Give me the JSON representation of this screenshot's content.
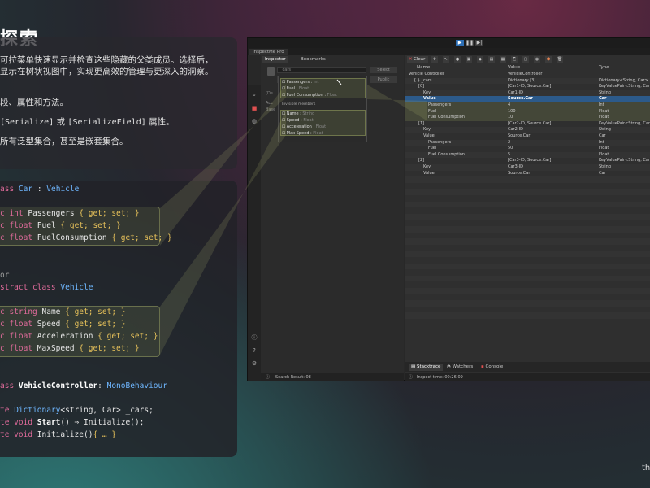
{
  "slide": {
    "title": "探索",
    "desc_lines": [
      "可拉菜单快速显示并检查这些隐藏的父类成员。选择后，",
      "显示在树状视图中，实现更高效的管理与更深入的洞察。",
      "段、属性和方法。",
      "或",
      "属性。",
      "所有泛型集合，甚至是嵌套集合。"
    ],
    "attr_serialize": "[Serialize]",
    "attr_serializefield": "[SerializeField]",
    "cut_text": "th"
  },
  "code": {
    "line1_kw": "ass",
    "line1_name": "Car",
    "line1_sep": ":",
    "line1_base": "Vehicle",
    "line2": "{",
    "p1_kw": "c int",
    "p1_name": "Passengers",
    "p2_kw": "c float",
    "p2_name": "Fuel",
    "p3_kw": "c float",
    "p3_name": "FuelConsumption",
    "accessors": "{ get; set; }",
    "line_or": "or",
    "abs_kw": "stract class",
    "abs_name": "Vehicle",
    "q1_kw": "c string",
    "q1_name": "Name",
    "q2_kw": "c float",
    "q2_name": "Speed",
    "q3_kw": "c float",
    "q3_name": "Acceleration",
    "q4_kw": "c float",
    "q4_name": "MaxSpeed",
    "vc_kw": "ass",
    "vc_name": "VehicleController",
    "vc_sep": ":",
    "vc_base": "MonoBehaviour",
    "f1_kw": "te",
    "f1_type": "Dictionary",
    "f1_generic": "<string, Car>",
    "f1_name": "_cars;",
    "f2_kw": "te void",
    "f2_name": "Start",
    "f2_rest": "() ⇒ Initialize();",
    "f3_kw": "te void",
    "f3_name": "Initialize",
    "f3_rest": "()",
    "f3_fold": "{ … }"
  },
  "unity": {
    "window_tab": "InspectMe Pro",
    "tabs": {
      "inspector": "Inspector",
      "bookmarks": "Bookmarks"
    },
    "cars_field": "_cars",
    "select_button": "Select",
    "public_label": "Public",
    "filter_placeholder": "",
    "dropdown": {
      "group1": [
        {
          "name": "Passengers",
          "type": "Int"
        },
        {
          "name": "Fuel",
          "type": "Float"
        },
        {
          "name": "Fuel Consumption",
          "type": "Float"
        }
      ],
      "invisible_label": "Invisible members",
      "group2": [
        {
          "name": "Name",
          "type": "String"
        },
        {
          "name": "Speed",
          "type": "Float"
        },
        {
          "name": "Acceleration",
          "type": "Float"
        },
        {
          "name": "Max Speed",
          "type": "Float"
        }
      ]
    },
    "left_labels": {
      "acc": "Acc",
      "base": "Base",
      "de": "(De"
    },
    "left_status": "Search Result: 08",
    "clear_button": "Clear",
    "columns": {
      "name": "Name",
      "value": "Value",
      "type": "Type"
    },
    "tree": [
      {
        "name": "Vehicle Controller",
        "value": "VehicleController",
        "type": ""
      },
      {
        "name": "{ } _cars",
        "value": "Dictionary [3]",
        "type": "Dictionary<String, Car>"
      },
      {
        "name": "[0]",
        "value": "[Car1-ID, Source.Car]",
        "type": "KeyValuePair<String, Car>"
      },
      {
        "name": "Key",
        "value": "Car1-ID",
        "type": "String"
      },
      {
        "name": "Value",
        "value": "Source.Car",
        "type": "Car"
      },
      {
        "name": "Passengers",
        "value": "4",
        "type": "Int"
      },
      {
        "name": "Fuel",
        "value": "100",
        "type": "Float"
      },
      {
        "name": "Fuel Consumption",
        "value": "10",
        "type": "Float"
      },
      {
        "name": "[1]",
        "value": "[Car2-ID, Source.Car]",
        "type": "KeyValuePair<String, Car>"
      },
      {
        "name": "Key",
        "value": "Car2-ID",
        "type": "String"
      },
      {
        "name": "Value",
        "value": "Source.Car",
        "type": "Car"
      },
      {
        "name": "Passengers",
        "value": "2",
        "type": "Int"
      },
      {
        "name": "Fuel",
        "value": "50",
        "type": "Float"
      },
      {
        "name": "Fuel Consumption",
        "value": "5",
        "type": "Float"
      },
      {
        "name": "[2]",
        "value": "[Car3-ID, Source.Car]",
        "type": "KeyValuePair<String, Car>"
      },
      {
        "name": "Key",
        "value": "Car3-ID",
        "type": "String"
      },
      {
        "name": "Value",
        "value": "Source.Car",
        "type": "Car"
      }
    ],
    "bottom_tabs": {
      "stacktrace": "Stacktrace",
      "watchers": "Watchers",
      "console": "Console"
    },
    "inspect_time": "Inspect time: 00:26:09"
  }
}
